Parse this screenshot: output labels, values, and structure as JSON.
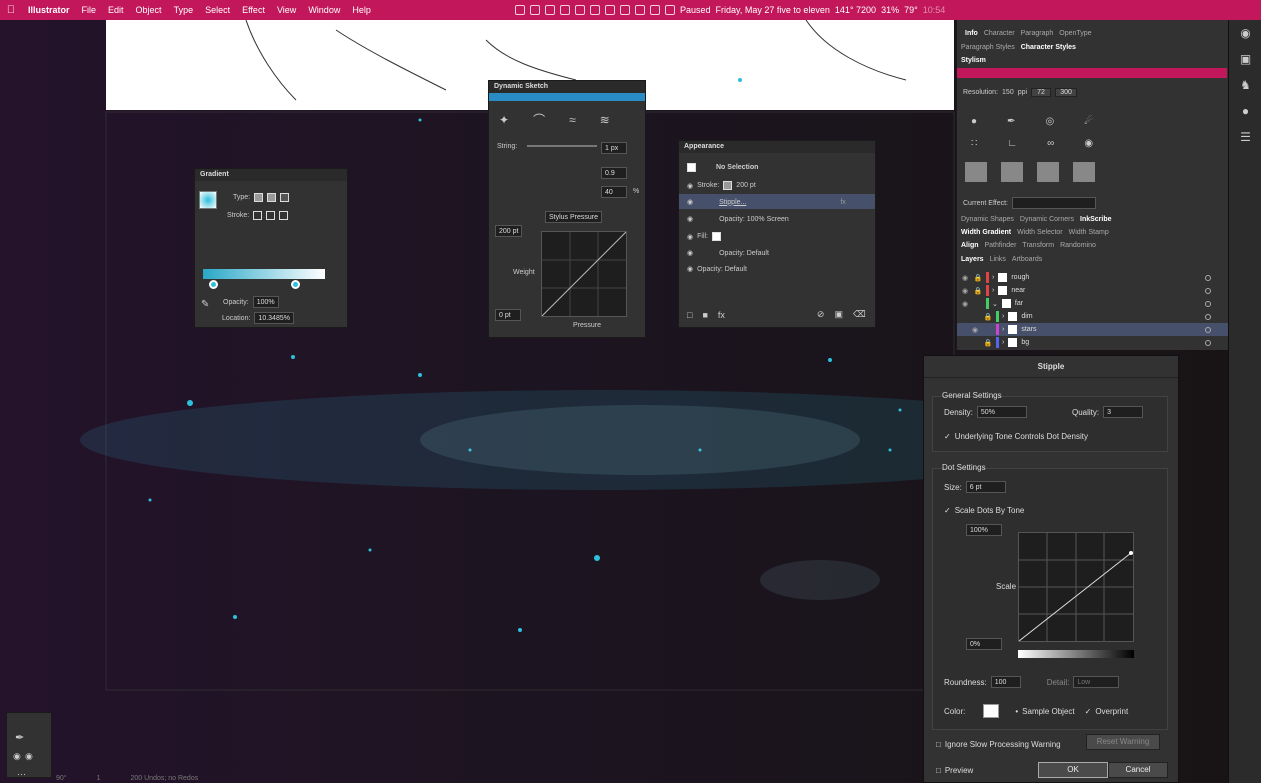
{
  "menubar": {
    "app": "Illustrator",
    "items": [
      "File",
      "Edit",
      "Object",
      "Type",
      "Select",
      "Effect",
      "View",
      "Window",
      "Help"
    ],
    "status": "Paused",
    "datetime": "Friday, May 27 five to eleven",
    "counter": "141° 7200",
    "battery": "31%",
    "temp": "79°",
    "time": "10:54"
  },
  "gradient_panel": {
    "title": "Gradient",
    "type_label": "Type:",
    "stroke_label": "Stroke:",
    "opacity_label": "Opacity:",
    "opacity_value": "100%",
    "location_label": "Location:",
    "location_value": "10.3485%"
  },
  "dynamic_sketch": {
    "title": "Dynamic Sketch",
    "string_label": "String:",
    "string_value": "1 px",
    "val1": "0.9",
    "val2": "40",
    "pct": "%",
    "stylus": "Stylus Pressure",
    "size_top": "200 pt",
    "size_bottom": "0 pt",
    "weight_label": "Weight",
    "pressure_label": "Pressure"
  },
  "appearance": {
    "title": "Appearance",
    "selection": "No Selection",
    "stroke_label": "Stroke:",
    "stroke_value": "200 pt",
    "stipple": "Stipple...",
    "opacity_screen": "Opacity: 100% Screen",
    "fill_label": "Fill:",
    "fill_opacity": "Opacity: Default",
    "opacity_default": "Opacity: Default"
  },
  "right_panel": {
    "tabs1": [
      "Info",
      "Character",
      "Paragraph",
      "OpenType"
    ],
    "tabs2": [
      "Paragraph Styles",
      "Character Styles"
    ],
    "stylism": "Stylism",
    "resolution_label": "Resolution:",
    "resolution_value": "150",
    "ppi": "ppi",
    "res_72": "72",
    "res_300": "300",
    "current_effect": "Current Effect:",
    "tabs3": [
      "Dynamic Shapes",
      "Dynamic Corners",
      "InkScribe"
    ],
    "tabs4": [
      "Width Gradient",
      "Width Selector",
      "Width Stamp"
    ],
    "tabs5": [
      "Align",
      "Pathfinder",
      "Transform",
      "Randomino"
    ],
    "tabs6": [
      "Layers",
      "Links",
      "Artboards"
    ]
  },
  "layers": [
    {
      "name": "rough",
      "color": "#e04444"
    },
    {
      "name": "near",
      "color": "#e04444"
    },
    {
      "name": "far",
      "color": "#44cc66"
    },
    {
      "name": "dim",
      "color": "#44cc66"
    },
    {
      "name": "stars",
      "color": "#cc44cc"
    },
    {
      "name": "bg",
      "color": "#5566ee"
    }
  ],
  "stipple": {
    "title": "Stipple",
    "general": "General Settings",
    "density_label": "Density:",
    "density_value": "50%",
    "quality_label": "Quality:",
    "quality_value": "3",
    "underlying": "Underlying Tone Controls Dot Density",
    "dot_settings": "Dot Settings",
    "size_label": "Size:",
    "size_value": "6 pt",
    "scale_dots": "Scale Dots By Tone",
    "pct_top": "100%",
    "scale_label": "Scale",
    "pct_bottom": "0%",
    "roundness_label": "Roundness:",
    "roundness_value": "100",
    "detail_label": "Detail:",
    "detail_value": "Low",
    "color_label": "Color:",
    "sample_object": "Sample Object",
    "overprint": "Overprint",
    "ignore_slow": "Ignore Slow Processing Warning",
    "reset_warning": "Reset Warning",
    "preview": "Preview",
    "ok": "OK",
    "cancel": "Cancel"
  },
  "statusbar": {
    "zoom": "90°",
    "page": "1",
    "undos": "200 Undos; no Redos"
  }
}
